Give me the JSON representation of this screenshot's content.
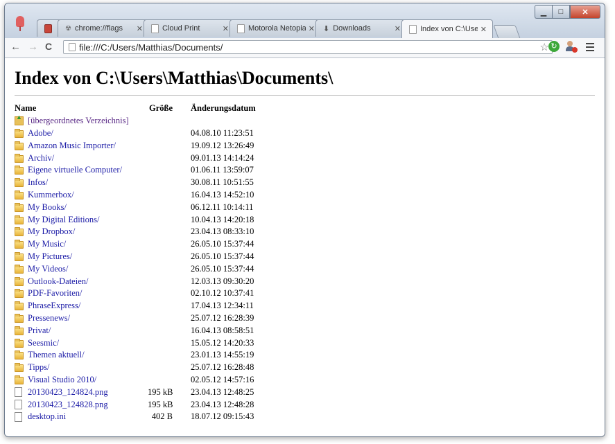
{
  "window": {
    "controls": {
      "minimize": "▁",
      "maximize": "□",
      "close": "✕"
    }
  },
  "tabs": [
    {
      "label": "",
      "icon": "app-icon",
      "active": false
    },
    {
      "label": "chrome://flags",
      "icon": "flags-icon",
      "active": false
    },
    {
      "label": "Cloud Print",
      "icon": "page-icon",
      "active": false
    },
    {
      "label": "Motorola Netopia Ro",
      "icon": "page-icon",
      "active": false
    },
    {
      "label": "Downloads",
      "icon": "download-icon",
      "active": false
    },
    {
      "label": "Index von C:\\Users\\M",
      "icon": "page-icon",
      "active": true
    }
  ],
  "toolbar": {
    "back": "←",
    "forward": "→",
    "reload": "C",
    "url": "file:///C:/Users/Matthias/Documents/",
    "star": "☆",
    "menu": "menu-icon"
  },
  "page": {
    "title": "Index von C:\\Users\\Matthias\\Documents\\",
    "headers": {
      "name": "Name",
      "size": "Größe",
      "date": "Änderungsdatum"
    },
    "parent_link": "[übergeordnetes Verzeichnis]",
    "entries": [
      {
        "name": "Adobe/",
        "size": "",
        "date": "04.08.10 11:23:51",
        "type": "folder"
      },
      {
        "name": "Amazon Music Importer/",
        "size": "",
        "date": "19.09.12 13:26:49",
        "type": "folder"
      },
      {
        "name": "Archiv/",
        "size": "",
        "date": "09.01.13 14:14:24",
        "type": "folder"
      },
      {
        "name": "Eigene virtuelle Computer/",
        "size": "",
        "date": "01.06.11 13:59:07",
        "type": "folder"
      },
      {
        "name": "Infos/",
        "size": "",
        "date": "30.08.11 10:51:55",
        "type": "folder"
      },
      {
        "name": "Kummerbox/",
        "size": "",
        "date": "16.04.13 14:52:10",
        "type": "folder"
      },
      {
        "name": "My Books/",
        "size": "",
        "date": "06.12.11 10:14:11",
        "type": "folder"
      },
      {
        "name": "My Digital Editions/",
        "size": "",
        "date": "10.04.13 14:20:18",
        "type": "folder"
      },
      {
        "name": "My Dropbox/",
        "size": "",
        "date": "23.04.13 08:33:10",
        "type": "folder"
      },
      {
        "name": "My Music/",
        "size": "",
        "date": "26.05.10 15:37:44",
        "type": "folder"
      },
      {
        "name": "My Pictures/",
        "size": "",
        "date": "26.05.10 15:37:44",
        "type": "folder"
      },
      {
        "name": "My Videos/",
        "size": "",
        "date": "26.05.10 15:37:44",
        "type": "folder"
      },
      {
        "name": "Outlook-Dateien/",
        "size": "",
        "date": "12.03.13 09:30:20",
        "type": "folder"
      },
      {
        "name": "PDF-Favoriten/",
        "size": "",
        "date": "02.10.12 10:37:41",
        "type": "folder"
      },
      {
        "name": "PhraseExpress/",
        "size": "",
        "date": "17.04.13 12:34:11",
        "type": "folder"
      },
      {
        "name": "Pressenews/",
        "size": "",
        "date": "25.07.12 16:28:39",
        "type": "folder"
      },
      {
        "name": "Privat/",
        "size": "",
        "date": "16.04.13 08:58:51",
        "type": "folder"
      },
      {
        "name": "Seesmic/",
        "size": "",
        "date": "15.05.12 14:20:33",
        "type": "folder"
      },
      {
        "name": "Themen aktuell/",
        "size": "",
        "date": "23.01.13 14:55:19",
        "type": "folder"
      },
      {
        "name": "Tipps/",
        "size": "",
        "date": "25.07.12 16:28:48",
        "type": "folder"
      },
      {
        "name": "Visual Studio 2010/",
        "size": "",
        "date": "02.05.12 14:57:16",
        "type": "folder"
      },
      {
        "name": "20130423_124824.png",
        "size": "195 kB",
        "date": "23.04.13 12:48:25",
        "type": "file"
      },
      {
        "name": "20130423_124828.png",
        "size": "195 kB",
        "date": "23.04.13 12:48:28",
        "type": "file"
      },
      {
        "name": "desktop.ini",
        "size": "402 B",
        "date": "18.07.12 09:15:43",
        "type": "file"
      }
    ]
  }
}
